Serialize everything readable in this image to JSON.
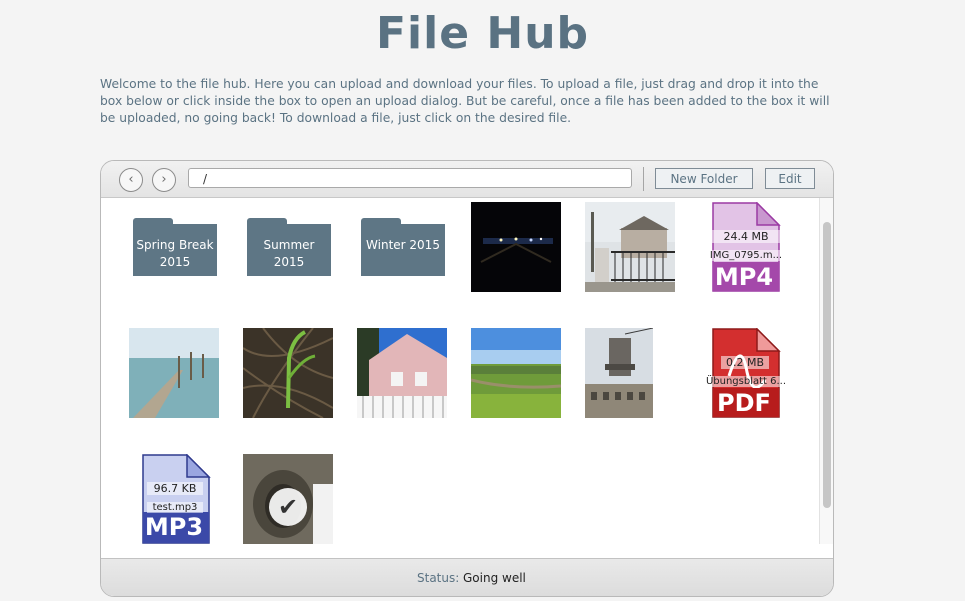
{
  "page": {
    "title": "File Hub",
    "intro": "Welcome to the file hub. Here you can upload and download your files. To upload a file, just drag and drop it into the box below or click inside the box to open an upload dialog. But be careful, once a file has been added to the box it will be uploaded, no going back! To download a file, just click on the desired file."
  },
  "toolbar": {
    "back_icon": "‹",
    "forward_icon": "›",
    "path": "/",
    "new_folder_label": "New Folder",
    "edit_label": "Edit"
  },
  "folders": [
    {
      "label": "Spring Break 2015"
    },
    {
      "label": "Summer 2015"
    },
    {
      "label": "Winter 2015"
    }
  ],
  "files": {
    "mp4": {
      "size": "24.4 MB",
      "name": "IMG_0795.m...",
      "ext": "MP4",
      "color": "#b04bb0"
    },
    "pdf": {
      "size": "0.2 MB",
      "name": "Übungsblatt 6...",
      "ext": "PDF",
      "color": "#c62828"
    },
    "mp3": {
      "size": "96.7 KB",
      "name": "test.mp3",
      "ext": "MP3",
      "color": "#3f4fb0"
    }
  },
  "status": {
    "label": "Status:",
    "value": "Going well"
  },
  "colors": {
    "accent": "#5a7282",
    "background": "#f4f4f4"
  }
}
